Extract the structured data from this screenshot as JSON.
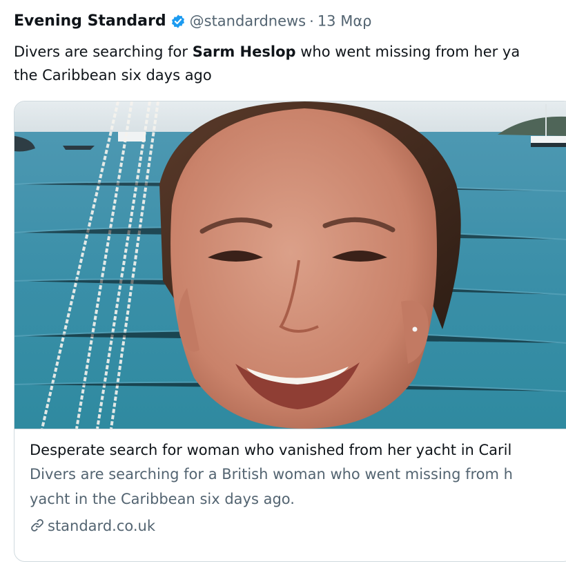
{
  "tweet": {
    "author_name": "Evening Standard",
    "handle": "@standardnews",
    "separator": "·",
    "date": "13 Μαρ",
    "text_line1_before": "Divers are searching for ",
    "text_line1_bold": "Sarm Heslop",
    "text_line1_after": " who went missing from her ya",
    "text_line2": "the Caribbean six days ago"
  },
  "card": {
    "image_icon": "photo-of-smiling-woman-on-yacht",
    "title": "Desperate search for woman who vanished from her yacht in Caril",
    "description_line1": "Divers are searching for a British woman who went missing from h",
    "description_line2": "yacht in the Caribbean six days ago.",
    "domain": "standard.co.uk"
  },
  "colors": {
    "verified_badge": "#1d9bf0",
    "text_primary": "#0f1419",
    "text_secondary": "#536471",
    "border": "#cfd9de",
    "sea": "#3a8fa8"
  }
}
